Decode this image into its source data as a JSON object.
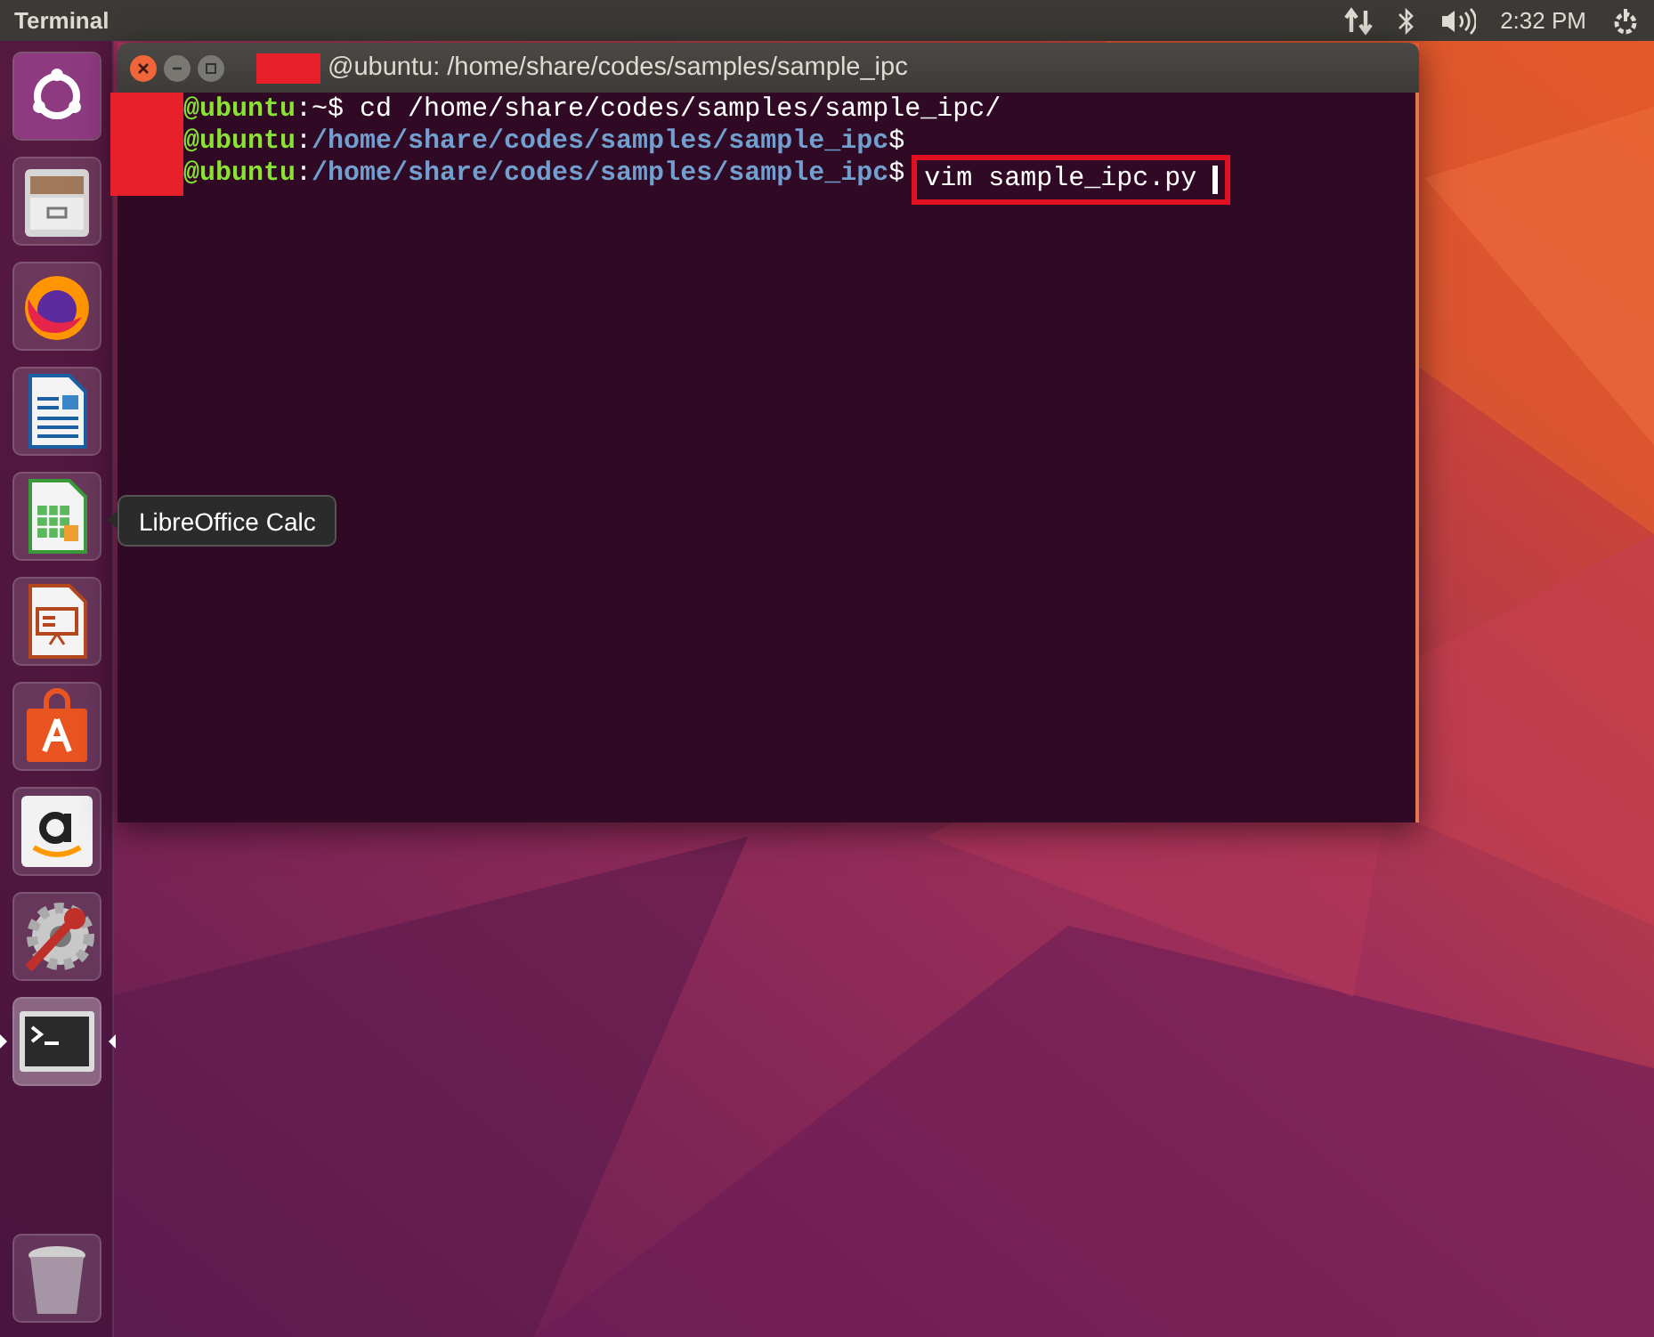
{
  "top_bar": {
    "app_name": "Terminal",
    "clock": "2:32 PM"
  },
  "launcher": {
    "items": [
      {
        "kind": "ubuntu",
        "active": false
      },
      {
        "kind": "files",
        "active": false
      },
      {
        "kind": "firefox",
        "active": false
      },
      {
        "kind": "writer",
        "active": false
      },
      {
        "kind": "calc",
        "active": false
      },
      {
        "kind": "impress",
        "active": false
      },
      {
        "kind": "store",
        "active": false
      },
      {
        "kind": "amazon",
        "active": false
      },
      {
        "kind": "settings",
        "active": false
      },
      {
        "kind": "terminal",
        "active": true
      }
    ],
    "trash": {
      "kind": "trash"
    }
  },
  "tooltip": {
    "text": "LibreOffice Calc"
  },
  "terminal": {
    "title": "@ubuntu: /home/share/codes/samples/sample_ipc",
    "lines": [
      {
        "parts": [
          {
            "kind": "host",
            "text": "@ubuntu"
          },
          {
            "kind": "plain",
            "text": ":~$ "
          }
        ],
        "command": {
          "text": "cd /home/share/codes/samples/sample_ipc/",
          "highlighted": false
        }
      },
      {
        "parts": [
          {
            "kind": "host",
            "text": "@ubuntu"
          },
          {
            "kind": "plain",
            "text": ":"
          },
          {
            "kind": "path",
            "text": "/home/share/codes/samples/sample_ipc"
          },
          {
            "kind": "plain",
            "text": "$"
          }
        ]
      },
      {
        "parts": [
          {
            "kind": "host",
            "text": "@ubuntu"
          },
          {
            "kind": "plain",
            "text": ":"
          },
          {
            "kind": "path",
            "text": "/home/share/codes/samples/sample_ipc"
          },
          {
            "kind": "plain",
            "text": "$"
          }
        ],
        "command": {
          "text": "vim sample_ipc.py",
          "highlighted": true
        },
        "cursor": true
      }
    ]
  }
}
